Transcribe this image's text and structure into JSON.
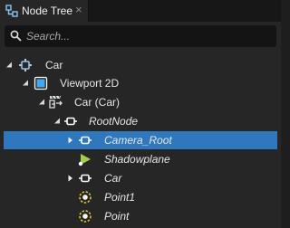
{
  "tab": {
    "label": "Node Tree",
    "close_label": "×"
  },
  "search": {
    "placeholder": "Search..."
  },
  "tree": [
    {
      "label": "Car",
      "italic": false,
      "expanded": true,
      "has_children": true,
      "icon": "node3d-icon",
      "selected": false
    },
    {
      "label": "Viewport 2D",
      "italic": false,
      "expanded": true,
      "has_children": true,
      "icon": "viewport-icon",
      "selected": false
    },
    {
      "label": "Car (Car)",
      "italic": false,
      "expanded": true,
      "has_children": true,
      "icon": "scene-instance-icon",
      "selected": false
    },
    {
      "label": "RootNode",
      "italic": true,
      "expanded": true,
      "has_children": true,
      "icon": "node-icon",
      "selected": false
    },
    {
      "label": "Camera_Root",
      "italic": true,
      "expanded": false,
      "has_children": true,
      "icon": "node-icon",
      "selected": true
    },
    {
      "label": "Shadowplane",
      "italic": true,
      "expanded": false,
      "has_children": false,
      "icon": "mesh-icon",
      "selected": false
    },
    {
      "label": "Car",
      "italic": true,
      "expanded": false,
      "has_children": true,
      "icon": "node-icon",
      "selected": false
    },
    {
      "label": "Point1",
      "italic": true,
      "expanded": false,
      "has_children": false,
      "icon": "light-icon",
      "selected": false
    },
    {
      "label": "Point",
      "italic": true,
      "expanded": false,
      "has_children": false,
      "icon": "light-icon",
      "selected": false
    }
  ],
  "colors": {
    "selected": "#2f78bd",
    "panel": "#262626",
    "field": "#141414",
    "light": "#e8c93a",
    "mesh": "#9bd24a",
    "viewport": "#41a9f0"
  }
}
